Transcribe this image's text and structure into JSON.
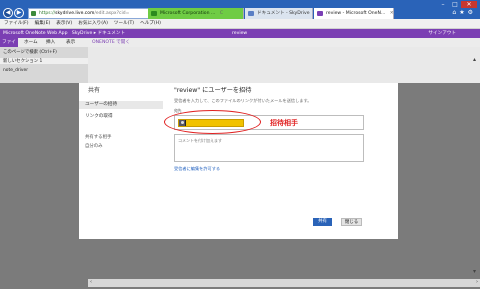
{
  "browser": {
    "address": {
      "https": "https://",
      "host": "skydrive.live.com",
      "path": "/edit.aspx?cid="
    },
    "tabs": [
      {
        "label": "Microsoft Corporation ..."
      },
      {
        "label": "ドキュメント - SkyDrive"
      },
      {
        "label": "review - Microsoft OneN..."
      }
    ],
    "menu": [
      "ファイル(F)",
      "編集(E)",
      "表示(V)",
      "お気に入り(A)",
      "ツール(T)",
      "ヘルプ(H)"
    ]
  },
  "app": {
    "header_left": "Microsoft OneNote Web App",
    "header_mid": "SkyDrive ▸ ドキュメント",
    "header_center": "review",
    "header_right": "サインアウト",
    "ribbon": [
      "ファイル",
      "ホーム",
      "挿入",
      "表示"
    ],
    "ribbon_open": "ONENOTE で開く",
    "left_pane": [
      "このページで検索 (Ctrl+F)",
      "新しいセクション 1",
      "note_driver"
    ]
  },
  "dialog": {
    "title": "共有",
    "nav": [
      {
        "label": "ユーザーの招待",
        "active": true
      },
      {
        "label": "リンクの取得",
        "active": false
      }
    ],
    "shared_label": "共有する相手",
    "shared_name": "自分のみ",
    "heading": "\"review\" にユーザーを招待",
    "description": "受信者を入力して、このファイルのリンクが付いたメールを送信します。",
    "to_label": "宛先",
    "annotation": "招待相手",
    "message_placeholder": "コメントを付け加えます",
    "require_link": "受信者に編集を許可する",
    "share_button": "共有",
    "close_button": "閉じる"
  }
}
